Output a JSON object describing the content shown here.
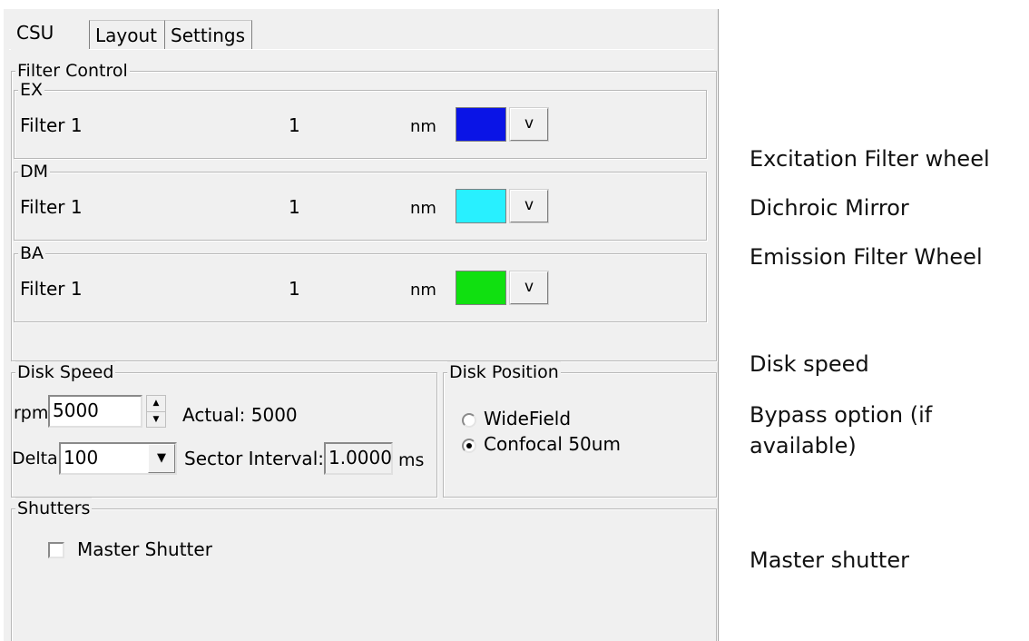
{
  "tabs": [
    "CSU",
    "Layout",
    "Settings"
  ],
  "filter_control": {
    "title": "Filter Control",
    "rows": [
      {
        "group": "EX",
        "filter": "Filter 1",
        "value": "1",
        "unit": "nm",
        "color": "#0a14e6",
        "button": "v"
      },
      {
        "group": "DM",
        "filter": "Filter 1",
        "value": "1",
        "unit": "nm",
        "color": "#28f0ff",
        "button": "v"
      },
      {
        "group": "BA",
        "filter": "Filter 1",
        "value": "1",
        "unit": "nm",
        "color": "#10e010",
        "button": "v"
      }
    ]
  },
  "disk_speed": {
    "title": "Disk Speed",
    "rpm_label": "rpm:",
    "rpm_value": "5000",
    "actual_text": "Actual: 5000",
    "delta_label": "Delta:",
    "delta_value": "100",
    "sector_label": "Sector Interval:",
    "sector_value": "1.0000",
    "sector_unit": "ms"
  },
  "disk_position": {
    "title": "Disk Position",
    "options": [
      {
        "label": "WideField",
        "selected": false
      },
      {
        "label": "Confocal 50um",
        "selected": true
      }
    ]
  },
  "shutters": {
    "title": "Shutters",
    "master_label": "Master Shutter",
    "master_checked": false
  },
  "annotations": [
    "Excitation Filter wheel",
    "Dichroic Mirror",
    "Emission Filter Wheel",
    "Disk speed",
    "Bypass option (if",
    "available)",
    "Master shutter"
  ]
}
